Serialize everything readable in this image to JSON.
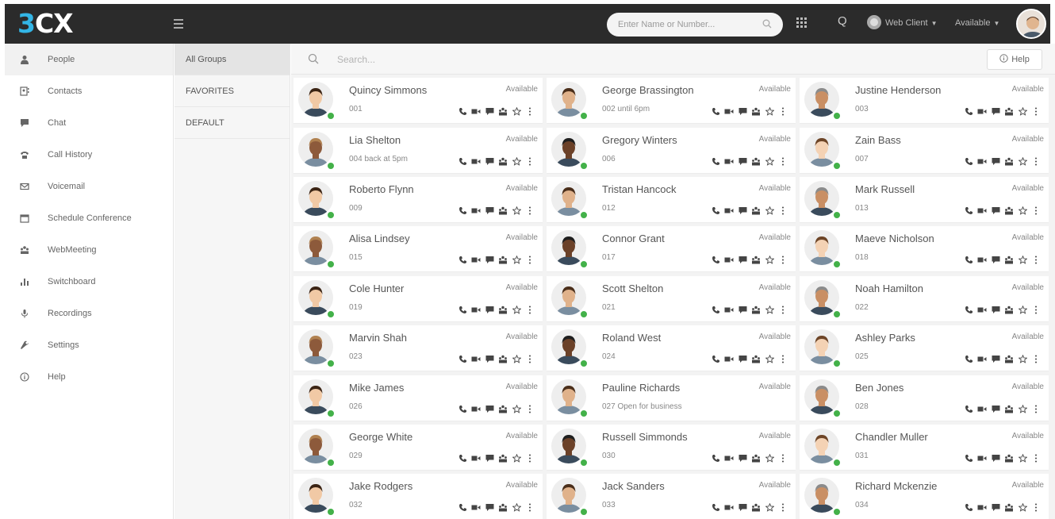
{
  "app": {
    "logo_number": "3",
    "logo_text": "CX"
  },
  "topbar": {
    "search_placeholder": "Enter Name or Number...",
    "q_label": "Q",
    "web_client": "Web Client",
    "status": "Available"
  },
  "sidebar": {
    "items": [
      {
        "label": "People",
        "icon": "person-icon"
      },
      {
        "label": "Contacts",
        "icon": "contacts-icon"
      },
      {
        "label": "Chat",
        "icon": "chat-icon"
      },
      {
        "label": "Call History",
        "icon": "phone-history-icon"
      },
      {
        "label": "Voicemail",
        "icon": "voicemail-icon"
      },
      {
        "label": "Schedule Conference",
        "icon": "calendar-icon"
      },
      {
        "label": "WebMeeting",
        "icon": "webmeeting-icon"
      },
      {
        "label": "Switchboard",
        "icon": "switchboard-icon"
      },
      {
        "label": "Recordings",
        "icon": "microphone-icon"
      },
      {
        "label": "Settings",
        "icon": "wrench-icon"
      },
      {
        "label": "Help",
        "icon": "info-icon"
      }
    ]
  },
  "groups": {
    "items": [
      "All Groups",
      "FAVORITES",
      "DEFAULT"
    ]
  },
  "main": {
    "search_placeholder": "Search...",
    "help_label": "Help"
  },
  "colors": {
    "accent": "#33b5e5",
    "online": "#43b149",
    "topbar": "#2b2b2b"
  },
  "people": [
    {
      "name": "Quincy Simmons",
      "ext": "001",
      "status": "Available"
    },
    {
      "name": "George Brassington",
      "ext": "002 until 6pm",
      "status": "Available"
    },
    {
      "name": "Justine Henderson",
      "ext": "003",
      "status": "Available"
    },
    {
      "name": "Lia Shelton",
      "ext": "004 back at 5pm",
      "status": "Available"
    },
    {
      "name": "Gregory Winters",
      "ext": "006",
      "status": "Available"
    },
    {
      "name": "Zain Bass",
      "ext": "007",
      "status": "Available"
    },
    {
      "name": "Roberto Flynn",
      "ext": "009",
      "status": "Available"
    },
    {
      "name": "Tristan Hancock",
      "ext": "012",
      "status": "Available"
    },
    {
      "name": "Mark Russell",
      "ext": "013",
      "status": "Available"
    },
    {
      "name": "Alisa Lindsey",
      "ext": "015",
      "status": "Available"
    },
    {
      "name": "Connor Grant",
      "ext": "017",
      "status": "Available"
    },
    {
      "name": "Maeve Nicholson",
      "ext": "018",
      "status": "Available"
    },
    {
      "name": "Cole Hunter",
      "ext": "019",
      "status": "Available"
    },
    {
      "name": "Scott Shelton",
      "ext": "021",
      "status": "Available"
    },
    {
      "name": "Noah Hamilton",
      "ext": "022",
      "status": "Available"
    },
    {
      "name": "Marvin Shah",
      "ext": "023",
      "status": "Available"
    },
    {
      "name": "Roland West",
      "ext": "024",
      "status": "Available"
    },
    {
      "name": "Ashley Parks",
      "ext": "025",
      "status": "Available"
    },
    {
      "name": "Mike James",
      "ext": "026",
      "status": "Available"
    },
    {
      "name": "Pauline Richards",
      "ext": "027 Open for business",
      "status": "Available"
    },
    {
      "name": "Ben Jones",
      "ext": "028",
      "status": "Available"
    },
    {
      "name": "George White",
      "ext": "029",
      "status": "Available"
    },
    {
      "name": "Russell Simmonds",
      "ext": "030",
      "status": "Available"
    },
    {
      "name": "Chandler Muller",
      "ext": "031",
      "status": "Available"
    },
    {
      "name": "Jake Rodgers",
      "ext": "032",
      "status": "Available"
    },
    {
      "name": "Jack Sanders",
      "ext": "033",
      "status": "Available"
    },
    {
      "name": "Richard Mckenzie",
      "ext": "034",
      "status": "Available"
    }
  ]
}
